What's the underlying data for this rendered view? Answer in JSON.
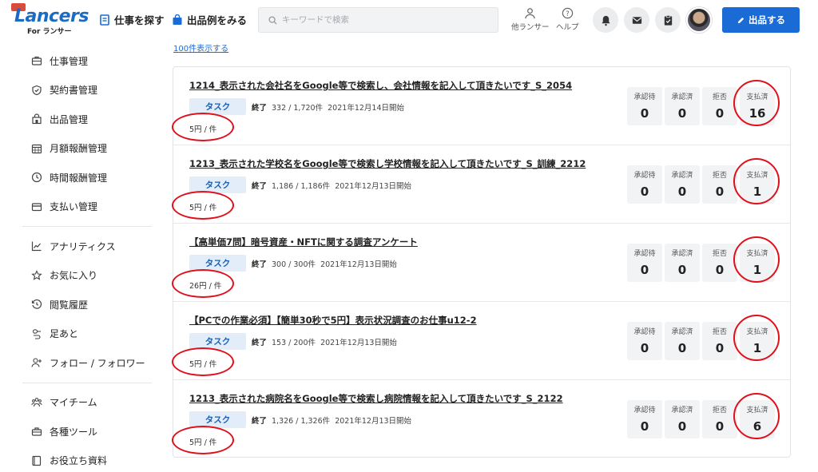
{
  "header": {
    "logo_text": "Lancers",
    "logo_sub": "For ランサー",
    "nav": [
      {
        "label": "仕事を探す",
        "icon": "document-icon"
      },
      {
        "label": "出品例をみる",
        "icon": "shop-bag-icon"
      }
    ],
    "search_placeholder": "キーワードで検索",
    "other_lancers": "他ランサー",
    "help": "ヘルプ",
    "post_button": "出品する"
  },
  "sidebar": {
    "groups": [
      [
        {
          "label": "仕事管理",
          "icon": "briefcase-icon"
        },
        {
          "label": "契約書管理",
          "icon": "shield-icon"
        },
        {
          "label": "出品管理",
          "icon": "store-icon"
        },
        {
          "label": "月額報酬管理",
          "icon": "calendar-icon"
        },
        {
          "label": "時間報酬管理",
          "icon": "clock-icon"
        },
        {
          "label": "支払い管理",
          "icon": "card-icon"
        }
      ],
      [
        {
          "label": "アナリティクス",
          "icon": "chart-icon"
        },
        {
          "label": "お気に入り",
          "icon": "star-icon"
        },
        {
          "label": "閲覧履歴",
          "icon": "history-icon"
        },
        {
          "label": "足あと",
          "icon": "footprint-icon"
        },
        {
          "label": "フォロー / フォロワー",
          "icon": "user-plus-icon"
        }
      ],
      [
        {
          "label": "マイチーム",
          "icon": "team-icon"
        },
        {
          "label": "各種ツール",
          "icon": "toolbox-icon"
        },
        {
          "label": "お役立ち資料",
          "icon": "book-icon"
        }
      ]
    ]
  },
  "main": {
    "show_more": "100件表示する",
    "stat_labels": [
      "承認待",
      "承認済",
      "拒否",
      "支払済"
    ],
    "rows": [
      {
        "title": "1214_表示された会社名をGoogle等で検索し、会社情報を記入して頂きたいです_S_2054",
        "tag": "タスク",
        "status": "終了",
        "progress": "332 / 1,720件",
        "started": "2021年12月14日開始",
        "price": "5円 / 件",
        "stats": [
          "0",
          "0",
          "0",
          "16"
        ]
      },
      {
        "title": "1213_表示された学校名をGoogle等で検索し学校情報を記入して頂きたいです_S_訓練_2212",
        "tag": "タスク",
        "status": "終了",
        "progress": "1,186 / 1,186件",
        "started": "2021年12月13日開始",
        "price": "5円 / 件",
        "stats": [
          "0",
          "0",
          "0",
          "1"
        ]
      },
      {
        "title": "【高単価7問】暗号資産・NFTに関する調査アンケート",
        "tag": "タスク",
        "status": "終了",
        "progress": "300 / 300件",
        "started": "2021年12月13日開始",
        "price": "26円 / 件",
        "stats": [
          "0",
          "0",
          "0",
          "1"
        ]
      },
      {
        "title": "【PCでの作業必須】【簡単30秒で5円】表示状況調査のお仕事u12-2",
        "tag": "タスク",
        "status": "終了",
        "progress": "153 / 200件",
        "started": "2021年12月13日開始",
        "price": "5円 / 件",
        "stats": [
          "0",
          "0",
          "0",
          "1"
        ]
      },
      {
        "title": "1213_表示された病院名をGoogle等で検索し病院情報を記入して頂きたいです_S_2122",
        "tag": "タスク",
        "status": "終了",
        "progress": "1,326 / 1,326件",
        "started": "2021年12月13日開始",
        "price": "5円 / 件",
        "stats": [
          "0",
          "0",
          "0",
          "6"
        ]
      }
    ]
  },
  "colors": {
    "accent": "#1a6bd6",
    "annotation": "#e0101b",
    "tag_bg": "#e3edfa"
  }
}
